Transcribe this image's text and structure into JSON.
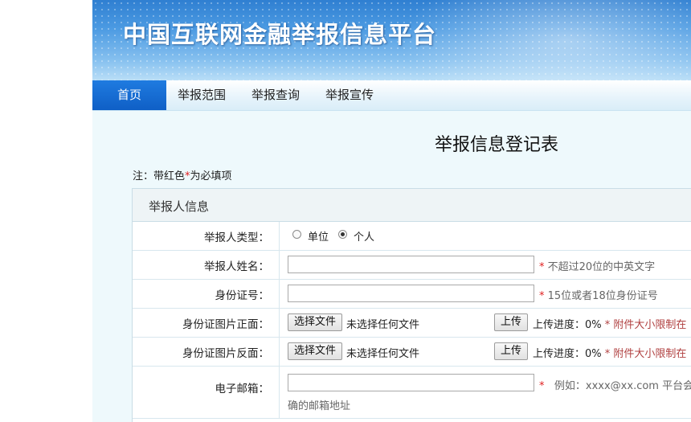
{
  "site": {
    "title": "中国互联网金融举报信息平台"
  },
  "nav": {
    "items": [
      "首页",
      "举报范围",
      "举报查询",
      "举报宣传"
    ]
  },
  "form": {
    "title": "举报信息登记表",
    "note_prefix": "注：带红色",
    "note_star": "*",
    "note_suffix": "为必填项",
    "section": "举报人信息",
    "rows": {
      "type": {
        "label": "举报人类型：",
        "options": [
          "单位",
          "个人"
        ],
        "selected": "个人"
      },
      "name": {
        "label": "举报人姓名：",
        "value": "",
        "required": "*",
        "hint": "不超过20位的中英文字"
      },
      "id": {
        "label": "身份证号：",
        "value": "",
        "required": "*",
        "hint": "15位或者18位身份证号"
      },
      "front": {
        "label": "身份证图片正面：",
        "choose": "选择文件",
        "nofile": "未选择任何文件",
        "upload": "上传",
        "progress": "上传进度：0%",
        "required": "*",
        "hint": "附件大小限制在"
      },
      "back": {
        "label": "身份证图片反面：",
        "choose": "选择文件",
        "nofile": "未选择任何文件",
        "upload": "上传",
        "progress": "上传进度：0%",
        "required": "*",
        "hint": "附件大小限制在"
      },
      "email": {
        "label": "电子邮箱：",
        "value": "",
        "required": "*",
        "hint": "例如：xxxx@xx.com 平台会",
        "hint_cont": "确的邮箱地址"
      }
    }
  },
  "colors": {
    "accent": "#1a6fd8",
    "required": "#e02020"
  }
}
